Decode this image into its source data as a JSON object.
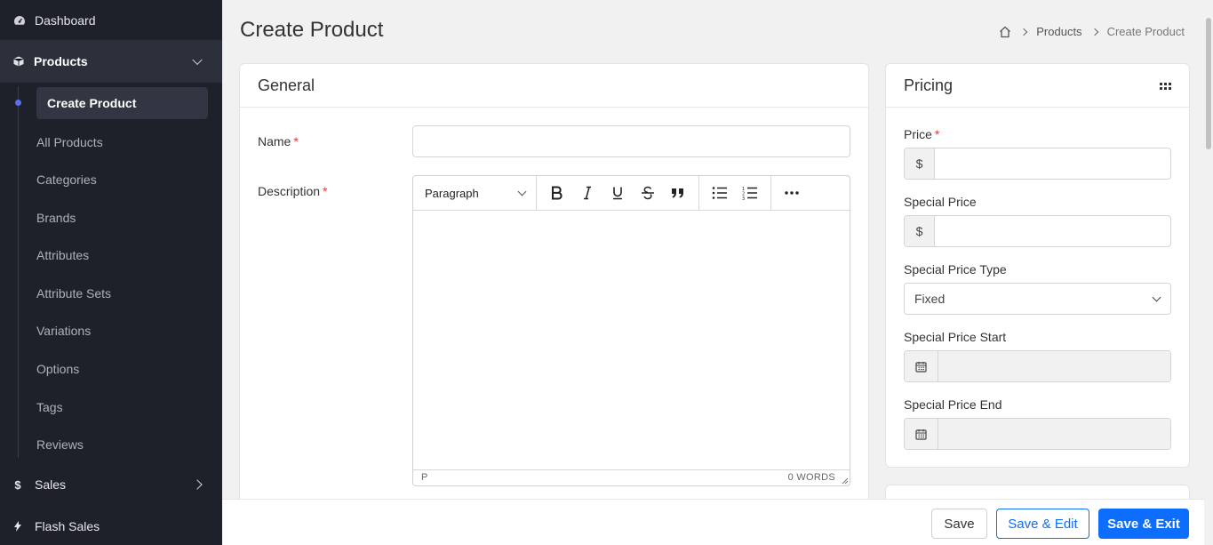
{
  "sidebar": {
    "dashboard": "Dashboard",
    "products": "Products",
    "sub_items": [
      "Create Product",
      "All Products",
      "Categories",
      "Brands",
      "Attributes",
      "Attribute Sets",
      "Variations",
      "Options",
      "Tags",
      "Reviews"
    ],
    "sales": "Sales",
    "flash_sales": "Flash Sales"
  },
  "header": {
    "title": "Create Product",
    "breadcrumb": [
      "Products",
      "Create Product"
    ]
  },
  "general": {
    "title": "General",
    "name_label": "Name",
    "description_label": "Description",
    "required_mark": "*",
    "editor": {
      "block_format": "Paragraph",
      "path": "P",
      "word_count": "0 WORDS"
    }
  },
  "pricing": {
    "title": "Pricing",
    "price_label": "Price",
    "special_price_label": "Special Price",
    "currency_symbol": "$",
    "special_price_type_label": "Special Price Type",
    "special_price_type_value": "Fixed",
    "special_price_start_label": "Special Price Start",
    "special_price_end_label": "Special Price End"
  },
  "footer": {
    "save": "Save",
    "save_edit": "Save & Edit",
    "save_exit": "Save & Exit"
  },
  "colors": {
    "sidebar_bg": "#1e212a",
    "accent": "#0d6efd",
    "active_dot": "#5b6ef5",
    "required": "#e53935"
  }
}
